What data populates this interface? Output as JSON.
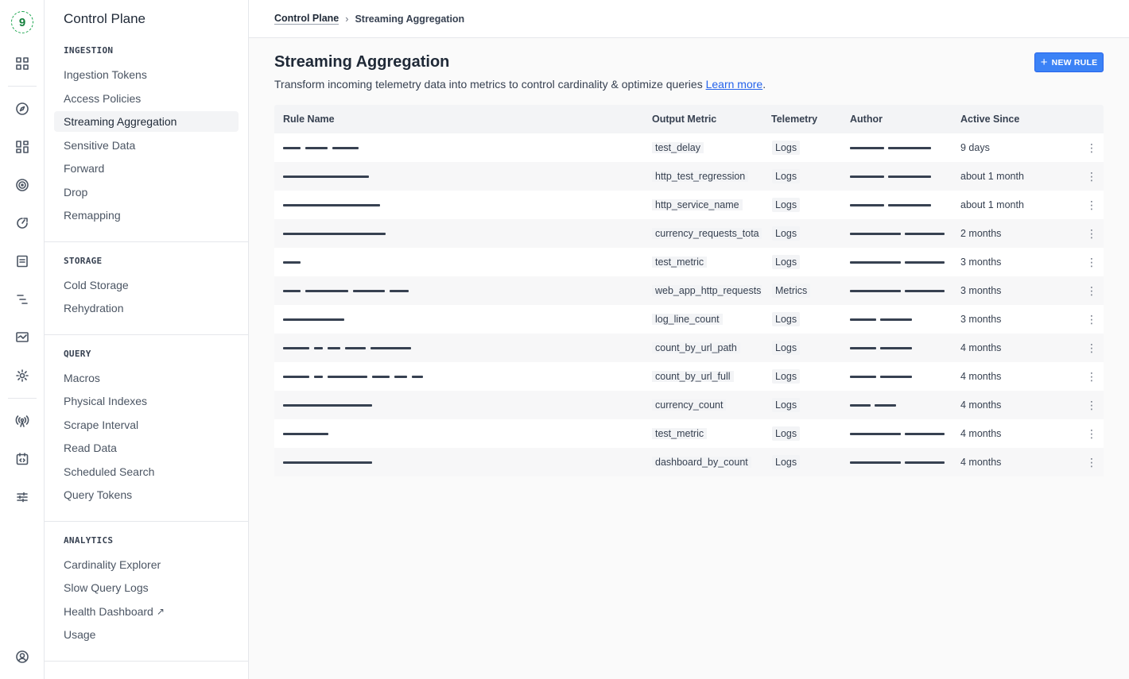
{
  "rail": {
    "logo_text": "9",
    "icons": [
      "apps-icon",
      "compass-icon",
      "dashboard-icon",
      "target-icon",
      "gauge-icon",
      "document-icon",
      "tree-icon",
      "monitor-icon",
      "settings-gear-icon",
      "antenna-icon",
      "calendar-code-icon",
      "sliders-icon",
      "user-circle-icon"
    ]
  },
  "subnav": {
    "title": "Control Plane",
    "sections": [
      {
        "heading": "INGESTION",
        "items": [
          "Ingestion Tokens",
          "Access Policies",
          "Streaming Aggregation",
          "Sensitive Data",
          "Forward",
          "Drop",
          "Remapping"
        ]
      },
      {
        "heading": "STORAGE",
        "items": [
          "Cold Storage",
          "Rehydration"
        ]
      },
      {
        "heading": "QUERY",
        "items": [
          "Macros",
          "Physical Indexes",
          "Scrape Interval",
          "Read Data",
          "Scheduled Search",
          "Query Tokens"
        ]
      },
      {
        "heading": "ANALYTICS",
        "items": [
          "Cardinality Explorer",
          "Slow Query Logs",
          "Health Dashboard",
          "Usage"
        ]
      }
    ],
    "active_item": "Streaming Aggregation",
    "external_arrow": "↗"
  },
  "breadcrumb": {
    "parent": "Control Plane",
    "separator": "›",
    "current": "Streaming Aggregation"
  },
  "page": {
    "title": "Streaming Aggregation",
    "description": "Transform incoming telemetry data into metrics to control cardinality & optimize queries ",
    "learn_more": "Learn more",
    "period": ".",
    "new_rule_icon": "+",
    "new_rule_label": "NEW RULE"
  },
  "table": {
    "headers": {
      "rule_name": "Rule Name",
      "output_metric": "Output Metric",
      "telemetry": "Telemetry",
      "author": "Author",
      "active_since": "Active Since"
    },
    "rows": [
      {
        "output_metric": "test_delay",
        "telemetry": "Logs",
        "active_since": "9 days"
      },
      {
        "output_metric": "http_test_regression",
        "telemetry": "Logs",
        "active_since": "about 1 month"
      },
      {
        "output_metric": "http_service_name",
        "telemetry": "Logs",
        "active_since": "about 1 month"
      },
      {
        "output_metric": "currency_requests_tota",
        "telemetry": "Logs",
        "active_since": "2 months"
      },
      {
        "output_metric": "test_metric",
        "telemetry": "Logs",
        "active_since": "3 months"
      },
      {
        "output_metric": "web_app_http_requests",
        "telemetry": "Metrics",
        "active_since": "3 months"
      },
      {
        "output_metric": "log_line_count",
        "telemetry": "Logs",
        "active_since": "3 months"
      },
      {
        "output_metric": "count_by_url_path",
        "telemetry": "Logs",
        "active_since": "4 months"
      },
      {
        "output_metric": "count_by_url_full",
        "telemetry": "Logs",
        "active_since": "4 months"
      },
      {
        "output_metric": "currency_count",
        "telemetry": "Logs",
        "active_since": "4 months"
      },
      {
        "output_metric": "test_metric",
        "telemetry": "Logs",
        "active_since": "4 months"
      },
      {
        "output_metric": "dashboard_by_count",
        "telemetry": "Logs",
        "active_since": "4 months"
      }
    ],
    "row_menu_icon": "⋮"
  },
  "colors": {
    "accent": "#3b82f6",
    "logo": "#16a34a",
    "link": "#2563eb"
  }
}
